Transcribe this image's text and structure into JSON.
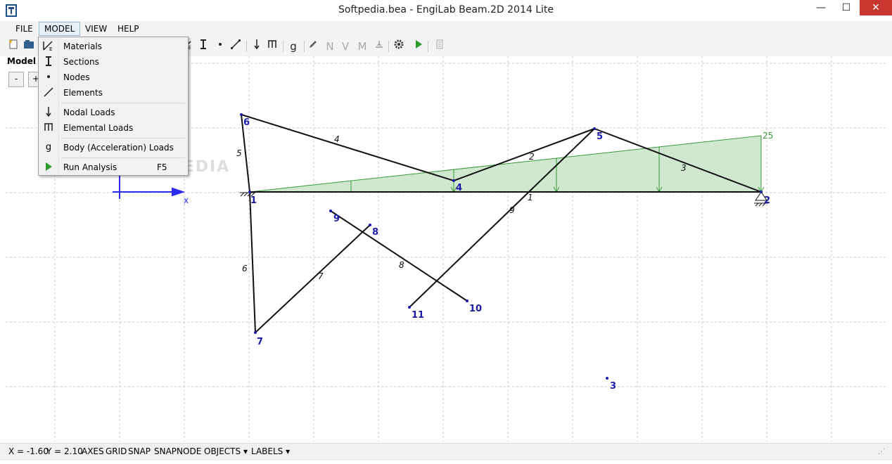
{
  "window": {
    "title": "Softpedia.bea - EngiLab Beam.2D 2014 Lite",
    "minimize": "—",
    "maximize": "☐",
    "close": "✕"
  },
  "menu": [
    {
      "label": "FILE"
    },
    {
      "label": "MODEL"
    },
    {
      "label": "VIEW"
    },
    {
      "label": "HELP"
    }
  ],
  "model_panel": {
    "label": "Model",
    "zoom_out": "-",
    "zoom_in": "+"
  },
  "dropdown": {
    "items": [
      {
        "label": "Materials",
        "icon": "materials-icon"
      },
      {
        "label": "Sections",
        "icon": "section-icon"
      },
      {
        "label": "Nodes",
        "icon": "node-icon"
      },
      {
        "label": "Elements",
        "icon": "element-icon"
      },
      {
        "label": "Nodal Loads",
        "icon": "nodal-load-icon"
      },
      {
        "label": "Elemental Loads",
        "icon": "elemental-load-icon"
      },
      {
        "label": "Body (Acceleration) Loads",
        "icon": "body-load-icon"
      },
      {
        "label": "Run Analysis",
        "shortcut": "F5",
        "icon": "run-icon"
      }
    ]
  },
  "toolbar_labels": {
    "body": "g",
    "n": "N",
    "v": "V",
    "m": "M"
  },
  "canvas": {
    "axis_x_label": "x",
    "load_value_label": "25",
    "node_labels": [
      "1",
      "2",
      "3",
      "4",
      "5",
      "6",
      "7",
      "8",
      "9",
      "10",
      "11"
    ],
    "element_labels": [
      "1",
      "2",
      "3",
      "4",
      "5",
      "6",
      "7",
      "8",
      "9"
    ]
  },
  "status": {
    "x": "X = -1.60",
    "y": "Y = 2.10",
    "axes": "AXES",
    "grid": "GRID",
    "snap": "SNAP",
    "snapnode": "SNAPNODE",
    "objects": "OBJECTS ▾",
    "labels": "LABELS ▾"
  },
  "watermark": "SOFTPEDIA",
  "colors": {
    "node": "#1a1aa8",
    "load": "#3a9a3a",
    "load_fill": "#cfe8cf",
    "axis": "#2d2df0",
    "grid": "#c8c8c8"
  }
}
